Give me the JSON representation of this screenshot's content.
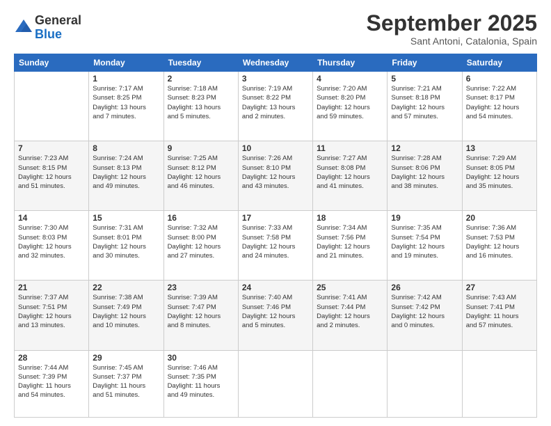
{
  "logo": {
    "general": "General",
    "blue": "Blue"
  },
  "title": "September 2025",
  "subtitle": "Sant Antoni, Catalonia, Spain",
  "weekdays": [
    "Sunday",
    "Monday",
    "Tuesday",
    "Wednesday",
    "Thursday",
    "Friday",
    "Saturday"
  ],
  "weeks": [
    [
      {
        "day": "",
        "info": ""
      },
      {
        "day": "1",
        "info": "Sunrise: 7:17 AM\nSunset: 8:25 PM\nDaylight: 13 hours\nand 7 minutes."
      },
      {
        "day": "2",
        "info": "Sunrise: 7:18 AM\nSunset: 8:23 PM\nDaylight: 13 hours\nand 5 minutes."
      },
      {
        "day": "3",
        "info": "Sunrise: 7:19 AM\nSunset: 8:22 PM\nDaylight: 13 hours\nand 2 minutes."
      },
      {
        "day": "4",
        "info": "Sunrise: 7:20 AM\nSunset: 8:20 PM\nDaylight: 12 hours\nand 59 minutes."
      },
      {
        "day": "5",
        "info": "Sunrise: 7:21 AM\nSunset: 8:18 PM\nDaylight: 12 hours\nand 57 minutes."
      },
      {
        "day": "6",
        "info": "Sunrise: 7:22 AM\nSunset: 8:17 PM\nDaylight: 12 hours\nand 54 minutes."
      }
    ],
    [
      {
        "day": "7",
        "info": "Sunrise: 7:23 AM\nSunset: 8:15 PM\nDaylight: 12 hours\nand 51 minutes."
      },
      {
        "day": "8",
        "info": "Sunrise: 7:24 AM\nSunset: 8:13 PM\nDaylight: 12 hours\nand 49 minutes."
      },
      {
        "day": "9",
        "info": "Sunrise: 7:25 AM\nSunset: 8:12 PM\nDaylight: 12 hours\nand 46 minutes."
      },
      {
        "day": "10",
        "info": "Sunrise: 7:26 AM\nSunset: 8:10 PM\nDaylight: 12 hours\nand 43 minutes."
      },
      {
        "day": "11",
        "info": "Sunrise: 7:27 AM\nSunset: 8:08 PM\nDaylight: 12 hours\nand 41 minutes."
      },
      {
        "day": "12",
        "info": "Sunrise: 7:28 AM\nSunset: 8:06 PM\nDaylight: 12 hours\nand 38 minutes."
      },
      {
        "day": "13",
        "info": "Sunrise: 7:29 AM\nSunset: 8:05 PM\nDaylight: 12 hours\nand 35 minutes."
      }
    ],
    [
      {
        "day": "14",
        "info": "Sunrise: 7:30 AM\nSunset: 8:03 PM\nDaylight: 12 hours\nand 32 minutes."
      },
      {
        "day": "15",
        "info": "Sunrise: 7:31 AM\nSunset: 8:01 PM\nDaylight: 12 hours\nand 30 minutes."
      },
      {
        "day": "16",
        "info": "Sunrise: 7:32 AM\nSunset: 8:00 PM\nDaylight: 12 hours\nand 27 minutes."
      },
      {
        "day": "17",
        "info": "Sunrise: 7:33 AM\nSunset: 7:58 PM\nDaylight: 12 hours\nand 24 minutes."
      },
      {
        "day": "18",
        "info": "Sunrise: 7:34 AM\nSunset: 7:56 PM\nDaylight: 12 hours\nand 21 minutes."
      },
      {
        "day": "19",
        "info": "Sunrise: 7:35 AM\nSunset: 7:54 PM\nDaylight: 12 hours\nand 19 minutes."
      },
      {
        "day": "20",
        "info": "Sunrise: 7:36 AM\nSunset: 7:53 PM\nDaylight: 12 hours\nand 16 minutes."
      }
    ],
    [
      {
        "day": "21",
        "info": "Sunrise: 7:37 AM\nSunset: 7:51 PM\nDaylight: 12 hours\nand 13 minutes."
      },
      {
        "day": "22",
        "info": "Sunrise: 7:38 AM\nSunset: 7:49 PM\nDaylight: 12 hours\nand 10 minutes."
      },
      {
        "day": "23",
        "info": "Sunrise: 7:39 AM\nSunset: 7:47 PM\nDaylight: 12 hours\nand 8 minutes."
      },
      {
        "day": "24",
        "info": "Sunrise: 7:40 AM\nSunset: 7:46 PM\nDaylight: 12 hours\nand 5 minutes."
      },
      {
        "day": "25",
        "info": "Sunrise: 7:41 AM\nSunset: 7:44 PM\nDaylight: 12 hours\nand 2 minutes."
      },
      {
        "day": "26",
        "info": "Sunrise: 7:42 AM\nSunset: 7:42 PM\nDaylight: 12 hours\nand 0 minutes."
      },
      {
        "day": "27",
        "info": "Sunrise: 7:43 AM\nSunset: 7:41 PM\nDaylight: 11 hours\nand 57 minutes."
      }
    ],
    [
      {
        "day": "28",
        "info": "Sunrise: 7:44 AM\nSunset: 7:39 PM\nDaylight: 11 hours\nand 54 minutes."
      },
      {
        "day": "29",
        "info": "Sunrise: 7:45 AM\nSunset: 7:37 PM\nDaylight: 11 hours\nand 51 minutes."
      },
      {
        "day": "30",
        "info": "Sunrise: 7:46 AM\nSunset: 7:35 PM\nDaylight: 11 hours\nand 49 minutes."
      },
      {
        "day": "",
        "info": ""
      },
      {
        "day": "",
        "info": ""
      },
      {
        "day": "",
        "info": ""
      },
      {
        "day": "",
        "info": ""
      }
    ]
  ]
}
